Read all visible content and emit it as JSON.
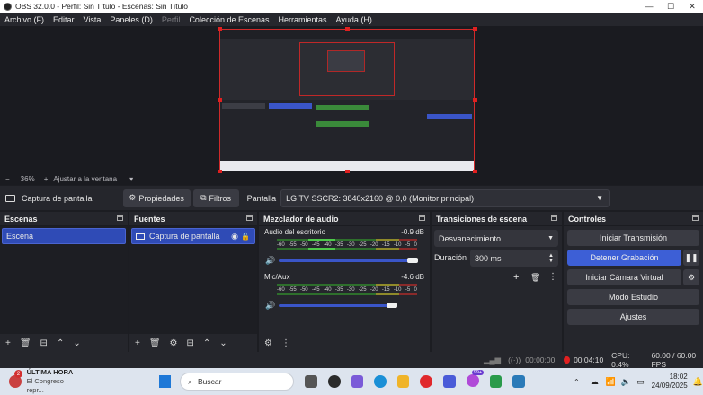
{
  "window": {
    "title": "OBS 32.0.0 - Perfil: Sin Título - Escenas: Sin Título",
    "controls": [
      "—",
      "☐",
      "✕"
    ]
  },
  "menu": [
    "Archivo (F)",
    "Editar",
    "Vista",
    "Paneles (D)",
    "Perfil",
    "Colección de Escenas",
    "Herramientas",
    "Ayuda (H)"
  ],
  "zoom": {
    "minus": "−",
    "value": "36%",
    "plus": "+",
    "fit_label": "Ajustar a la ventana"
  },
  "source_bar": {
    "source_name": "Captura de pantalla",
    "properties_label": "Propiedades",
    "filters_label": "Filtros",
    "screen_label": "Pantalla",
    "screen_value": "LG TV SSCR2: 3840x2160 @ 0,0 (Monitor principal)"
  },
  "scenes": {
    "title": "Escenas",
    "items": [
      "Escena"
    ]
  },
  "sources": {
    "title": "Fuentes",
    "items": [
      "Captura de pantalla"
    ]
  },
  "mixer": {
    "title": "Mezclador de audio",
    "scale": [
      "-60",
      "-55",
      "-50",
      "-45",
      "-40",
      "-35",
      "-30",
      "-25",
      "-20",
      "-15",
      "-10",
      "-5",
      "0"
    ],
    "tracks": [
      {
        "name": "Audio del escritorio",
        "db": "-0.9 dB",
        "volume": 0.98
      },
      {
        "name": "Mic/Aux",
        "db": "-4.6 dB",
        "volume": 0.85
      }
    ]
  },
  "transitions": {
    "title": "Transiciones de escena",
    "selected": "Desvanecimiento",
    "duration_label": "Duración",
    "duration_value": "300 ms"
  },
  "controls": {
    "title": "Controles",
    "start_stream": "Iniciar Transmisión",
    "stop_recording": "Detener Grabación",
    "virtual_camera": "Iniciar Cámara Virtual",
    "studio_mode": "Modo Estudio",
    "settings": "Ajustes"
  },
  "status": {
    "stream_time": "00:00:00",
    "rec_time": "00:04:10",
    "cpu": "CPU: 0.4%",
    "fps": "60.00 / 60.00 FPS"
  },
  "taskbar": {
    "news_badge": "2",
    "news_title": "ÚLTIMA HORA",
    "news_sub": "El Congreso repr...",
    "search_placeholder": "Buscar",
    "time": "18:02",
    "date": "24/09/2025",
    "notif_badge": "99+"
  },
  "colors": {
    "accent": "#3a5bd9",
    "recording": "#e02020",
    "meter_green": "#4ec94a"
  }
}
